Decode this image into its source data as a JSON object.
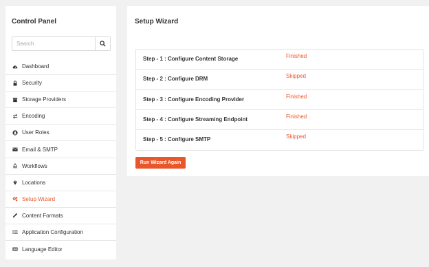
{
  "sidebar": {
    "title": "Control Panel",
    "search_placeholder": "Search",
    "items": [
      {
        "label": "Dashboard",
        "icon": "dashboard-icon"
      },
      {
        "label": "Security",
        "icon": "lock-icon"
      },
      {
        "label": "Storage Providers",
        "icon": "storage-icon"
      },
      {
        "label": "Encoding",
        "icon": "exchange-icon"
      },
      {
        "label": "User Roles",
        "icon": "user-icon"
      },
      {
        "label": "Email & SMTP",
        "icon": "envelope-icon"
      },
      {
        "label": "Workflows",
        "icon": "recycle-icon"
      },
      {
        "label": "Locations",
        "icon": "map-marker-icon"
      },
      {
        "label": "Setup Wizard",
        "icon": "cogs-icon",
        "active": true
      },
      {
        "label": "Content Formats",
        "icon": "pencil-icon"
      },
      {
        "label": "Application Configuration",
        "icon": "list-icon"
      },
      {
        "label": "Language Editor",
        "icon": "language-icon"
      }
    ]
  },
  "main": {
    "title": "Setup Wizard",
    "steps": [
      {
        "label": "Step - 1 : Configure Content Storage",
        "status": "Finished"
      },
      {
        "label": "Step - 2 : Configure DRM",
        "status": "Skipped"
      },
      {
        "label": "Step - 3 : Configure Encoding Provider",
        "status": "Finished"
      },
      {
        "label": "Step - 4 : Configure Streaming Endpoint",
        "status": "Finished"
      },
      {
        "label": "Step - 5 : Configure SMTP",
        "status": "Skipped"
      }
    ],
    "run_button": "Run Wizard Again"
  },
  "colors": {
    "accent": "#e8562a",
    "background": "#f1f1f1"
  }
}
